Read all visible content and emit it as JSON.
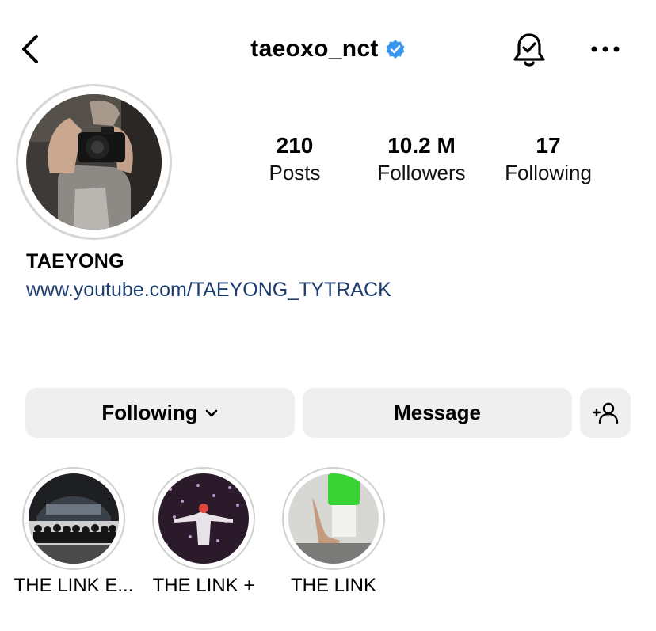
{
  "header": {
    "username": "taeoxo_nct",
    "icons": {
      "back": "chevron-left-icon",
      "verified": "verified-badge-icon",
      "bell": "notification-bell-check-icon",
      "more": "more-horizontal-icon"
    }
  },
  "profile": {
    "stats": [
      {
        "value": "210",
        "label": "Posts"
      },
      {
        "value": "10.2 M",
        "label": "Followers"
      },
      {
        "value": "17",
        "label": "Following"
      }
    ],
    "display_name": "TAEYONG",
    "website": "www.youtube.com/TAEYONG_TYTRACK"
  },
  "actions": {
    "following_label": "Following",
    "message_label": "Message",
    "add_user_icon": "add-person-icon"
  },
  "highlights": [
    {
      "label": "THE LINK E..."
    },
    {
      "label": "THE LINK +"
    },
    {
      "label": "THE LINK"
    }
  ],
  "colors": {
    "verified": "#3897f0",
    "link": "#1c3d6e",
    "button_bg": "#efefef"
  }
}
